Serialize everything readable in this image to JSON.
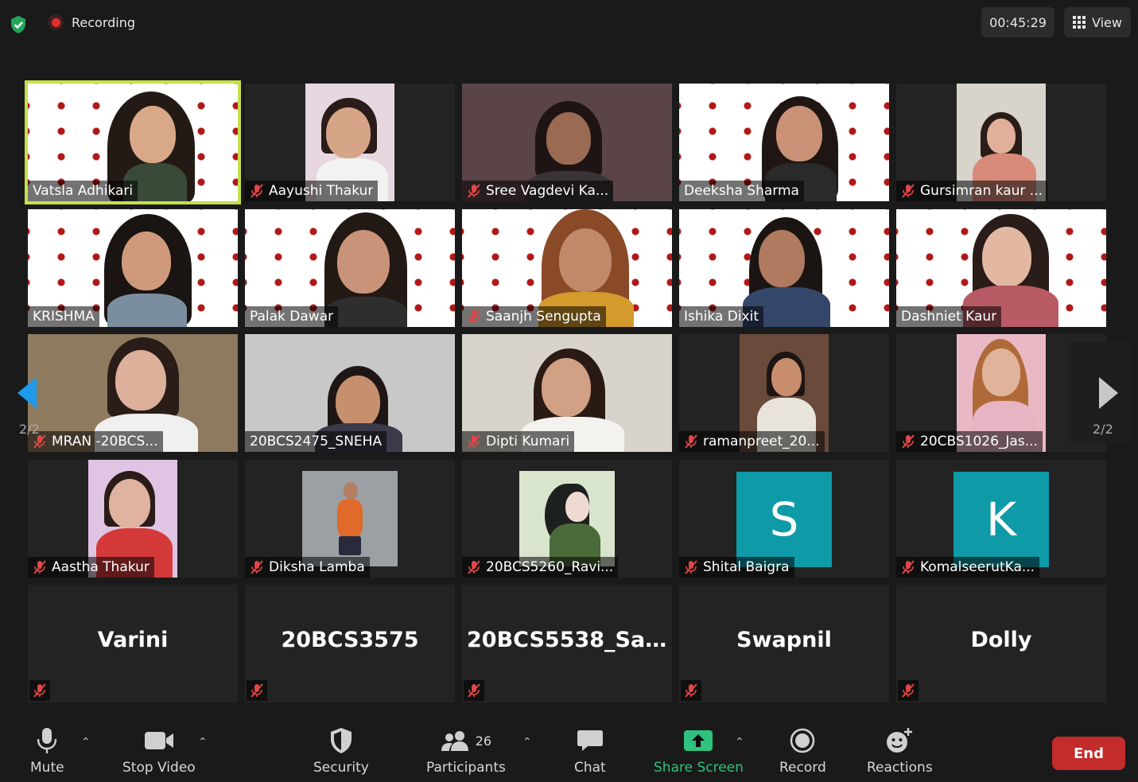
{
  "meeting": {
    "recording_label": "Recording",
    "timer": "00:45:29",
    "view_label": "View"
  },
  "pager": {
    "left_label": "2/2",
    "right_label": "2/2"
  },
  "tiles": [
    {
      "name": "Vatsla Adhikari",
      "muted": false
    },
    {
      "name": "Aayushi Thakur",
      "muted": true
    },
    {
      "name": "Sree Vagdevi Ka...",
      "muted": true
    },
    {
      "name": "Deeksha Sharma",
      "muted": false
    },
    {
      "name": "Gursimran kaur ...",
      "muted": true
    },
    {
      "name": "KRISHMA",
      "muted": false
    },
    {
      "name": "Palak Dawar",
      "muted": false
    },
    {
      "name": "Saanjh Sengupta",
      "muted": true
    },
    {
      "name": "Ishika Dixit",
      "muted": false
    },
    {
      "name": "Dashniet Kaur",
      "muted": false
    },
    {
      "name": "MRAN -20BCS...",
      "muted": true
    },
    {
      "name": "20BCS2475_SNEHA",
      "muted": false
    },
    {
      "name": "Dipti Kumari",
      "muted": true
    },
    {
      "name": "ramanpreet_20...",
      "muted": true
    },
    {
      "name": "20CBS1026_Jas...",
      "muted": true
    },
    {
      "name": "Aastha Thakur",
      "muted": true
    },
    {
      "name": "Diksha Lamba",
      "muted": true
    },
    {
      "name": "20BCS5260_Ravi...",
      "muted": true
    },
    {
      "name": "Shital Baigra",
      "muted": true,
      "avatar_letter": "S"
    },
    {
      "name": "KomalseerutKa...",
      "muted": true,
      "avatar_letter": "K"
    },
    {
      "name": "Varini",
      "muted": true
    },
    {
      "name": "20BCS3575",
      "muted": true
    },
    {
      "name": "20BCS5538_San...",
      "muted": true
    },
    {
      "name": "Swapnil",
      "muted": true
    },
    {
      "name": "Dolly",
      "muted": true
    }
  ],
  "colors": {
    "active_speaker": "#c6e04a",
    "avatar_bg": "#0e9aa7",
    "end": "#c42b2b",
    "share": "#2ec27e"
  },
  "toolbar": {
    "mute_label": "Mute",
    "stop_video_label": "Stop Video",
    "security_label": "Security",
    "participants_label": "Participants",
    "participants_count": "26",
    "chat_label": "Chat",
    "share_screen_label": "Share Screen",
    "record_label": "Record",
    "reactions_label": "Reactions",
    "end_label": "End"
  },
  "icons": [
    "shield-check-icon",
    "record-icon",
    "grid-icon",
    "mic-muted-icon",
    "mic-icon",
    "video-camera-icon",
    "shield-icon",
    "participants-icon",
    "chat-bubble-icon",
    "share-arrow-icon",
    "record-circle-icon",
    "emoji-plus-icon",
    "chevron-up-icon",
    "arrow-left-icon",
    "arrow-right-icon"
  ]
}
